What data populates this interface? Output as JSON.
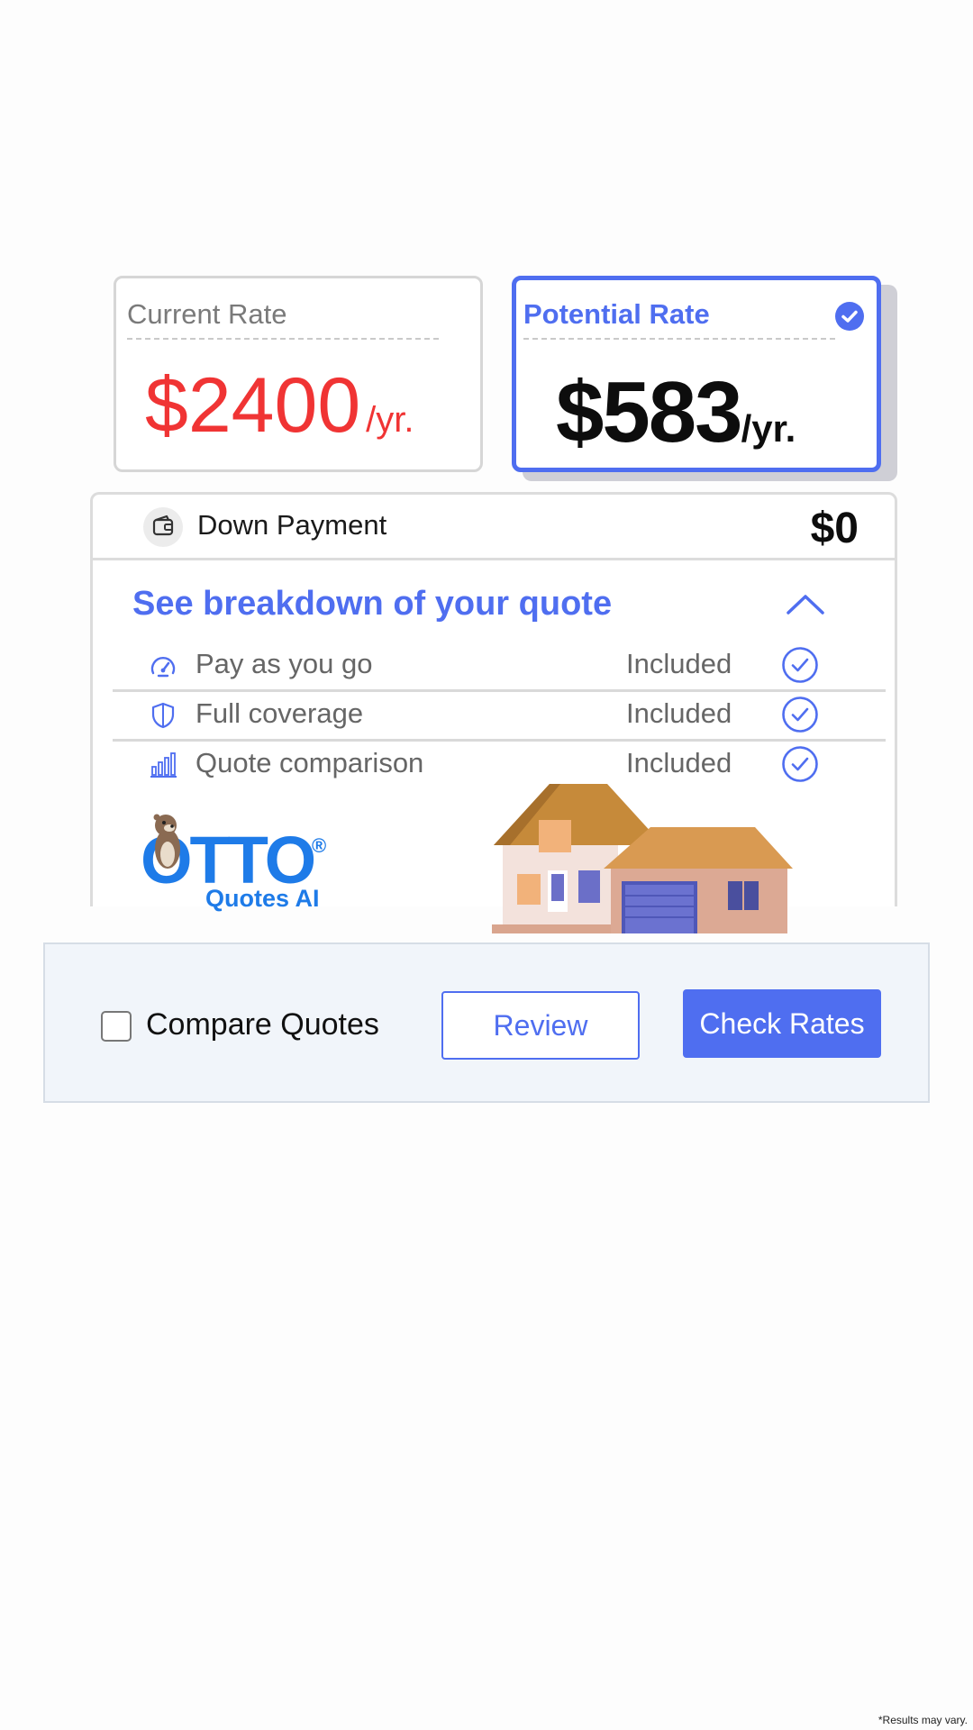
{
  "current_rate": {
    "label": "Current Rate",
    "amount": "$2400",
    "unit": "/yr."
  },
  "potential_rate": {
    "label": "Potential Rate",
    "amount": "$583",
    "unit": "/yr.",
    "selected": true
  },
  "down_payment": {
    "label": "Down Payment",
    "value": "$0",
    "icon": "wallet-icon"
  },
  "breakdown": {
    "title": "See breakdown of your quote",
    "expanded": true,
    "items": [
      {
        "label": "Pay as you go",
        "status": "Included",
        "icon": "speedometer-icon"
      },
      {
        "label": "Full coverage",
        "status": "Included",
        "icon": "shield-icon"
      },
      {
        "label": "Quote comparison",
        "status": "Included",
        "icon": "bar-chart-icon"
      }
    ]
  },
  "logo": {
    "name": "OTTO",
    "reg": "®",
    "tagline": "Quotes AI"
  },
  "actions": {
    "compare_label": "Compare Quotes",
    "compare_checked": false,
    "review_label": "Review",
    "check_rates_label": "Check Rates"
  },
  "disclaimer": "*Results may vary.",
  "colors": {
    "accent": "#4f6ef0",
    "current_price": "#f03434",
    "logo_blue": "#1e7be8"
  }
}
